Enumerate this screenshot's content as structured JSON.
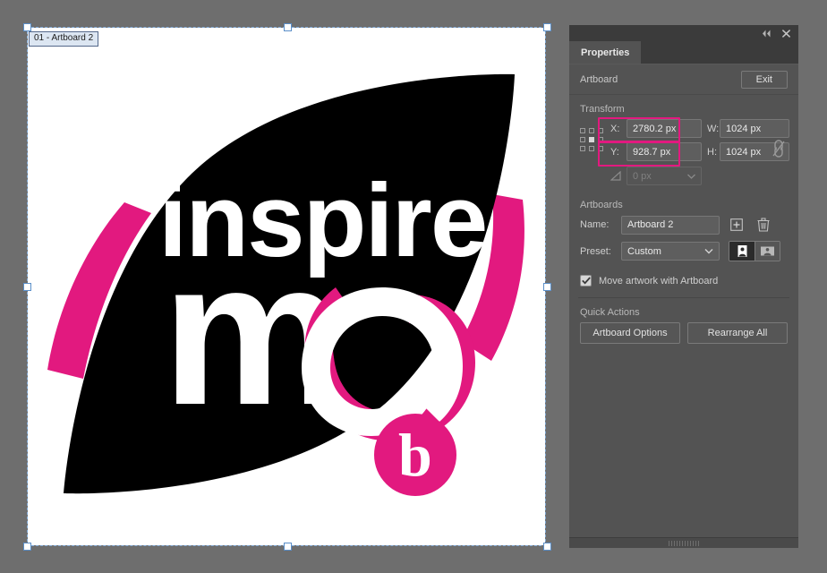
{
  "app": {
    "canvas_background": "#6e6e6e",
    "accent_magenta": "#e2197f",
    "panel_background": "#535353"
  },
  "canvas": {
    "artboard_label": "01 - Artboard 2",
    "artboard_fill": "#ffffff",
    "selection_color": "#7fa8d4",
    "artwork": {
      "title": "inspire me",
      "wordmark_line1": "inspire",
      "wordmark_line2": "me",
      "badge_letter": "b",
      "leaf_fill": "#000000",
      "accent_fill": "#e2197f",
      "text_fill": "#ffffff"
    }
  },
  "panel": {
    "titlebar": {
      "collapse_icon": "double-chevron-left-icon",
      "close_icon": "close-icon"
    },
    "tabs": [
      {
        "label": "Properties",
        "active": true
      }
    ],
    "header": {
      "label": "Artboard",
      "exit_label": "Exit"
    },
    "transform": {
      "section_title": "Transform",
      "reference_point_icon": "reference-point-grid-icon",
      "x_label": "X:",
      "x_value": "2780.2 px",
      "y_label": "Y:",
      "y_value": "928.7 px",
      "w_label": "W:",
      "w_value": "1024 px",
      "h_label": "H:",
      "h_value": "1024 px",
      "link_icon": "broken-chain-link-icon",
      "shear_icon": "shear-angle-icon",
      "shear_label": "∠:",
      "shear_value": "0 px",
      "highlighted_fields": [
        "x_value",
        "y_value"
      ]
    },
    "artboards": {
      "section_title": "Artboards",
      "name_label": "Name:",
      "name_value": "Artboard 2",
      "add_icon": "plus-square-icon",
      "delete_icon": "trash-icon",
      "preset_label": "Preset:",
      "preset_value": "Custom",
      "preset_caret_icon": "chevron-down-icon",
      "orientation": {
        "portrait_icon": "portrait-orientation-icon",
        "landscape_icon": "landscape-orientation-icon",
        "selected": "portrait"
      },
      "move_artwork_label": "Move artwork with Artboard",
      "move_artwork_checked": true,
      "check_icon": "checkmark-icon"
    },
    "quick_actions": {
      "section_title": "Quick Actions",
      "artboard_options_label": "Artboard Options",
      "rearrange_all_label": "Rearrange All"
    },
    "resize_grip_icon": "resize-grip-icon"
  }
}
